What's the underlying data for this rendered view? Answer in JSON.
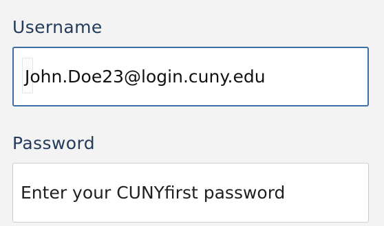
{
  "login_form": {
    "username_label": "Username",
    "username_value": "John.Doe23@login.cuny.edu",
    "password_label": "Password",
    "password_placeholder": "Enter your CUNYfirst password"
  }
}
